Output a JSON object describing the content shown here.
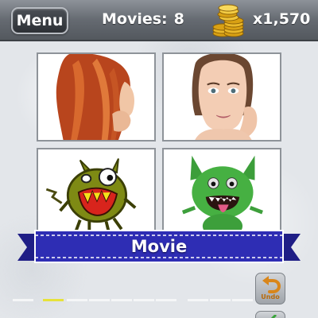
{
  "header": {
    "menu_label": "Menu",
    "movies_label": "Movies:",
    "movies_count": "8",
    "coins_icon": "gold-coins-stack-icon",
    "coin_total": "x1,570"
  },
  "puzzle": {
    "images": [
      {
        "name": "red-hair-woman-image"
      },
      {
        "name": "face-skincare-woman-image"
      },
      {
        "name": "green-cartoon-monster-image"
      },
      {
        "name": "furry-green-monster-image"
      }
    ],
    "category_label": "Movie"
  },
  "answer": {
    "slot_count": 12,
    "filled_slots": 1
  },
  "controls": {
    "undo_label": "Undo",
    "undo_icon": "undo-arrow-icon",
    "next_icon": "checkmark-icon"
  },
  "colors": {
    "ribbon": "#2e2db4",
    "coin": "#e5b21f",
    "active_slot": "#e7e23a"
  }
}
